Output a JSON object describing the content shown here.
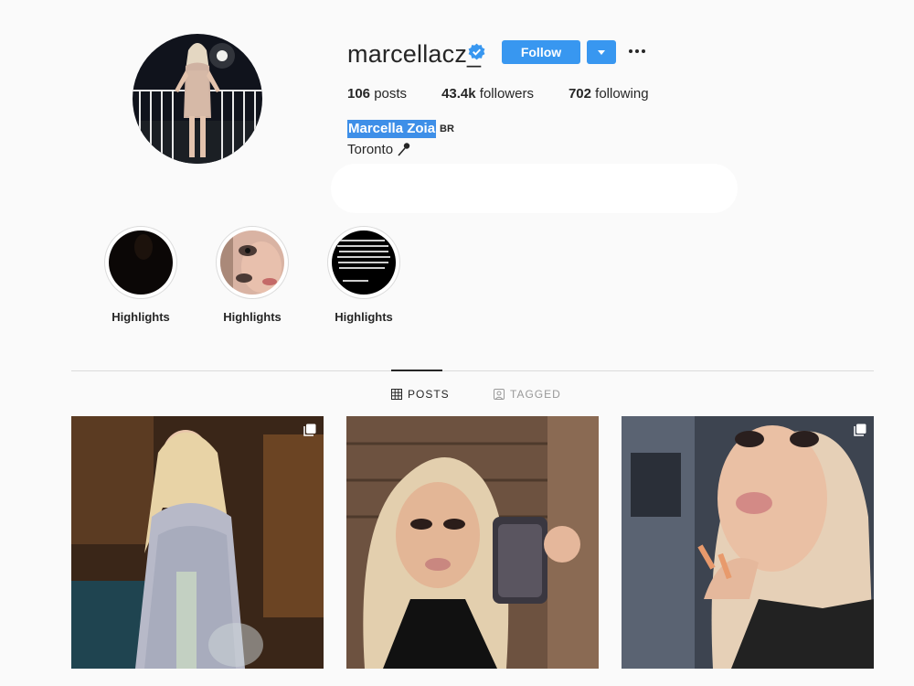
{
  "profile": {
    "username": "marcellacz_",
    "verified_icon": "verified-badge-icon",
    "follow_label": "Follow",
    "stats": {
      "posts_count": "106",
      "posts_label": " posts",
      "followers_count": "43.4k",
      "followers_label": " followers",
      "following_count": "702",
      "following_label": " following"
    },
    "full_name": "Marcella Zoia",
    "name_badge": "BR",
    "location": "Toronto"
  },
  "highlights": [
    {
      "label": "Highlights"
    },
    {
      "label": "Highlights"
    },
    {
      "label": "Highlights"
    }
  ],
  "tabs": {
    "posts": "POSTS",
    "tagged": "TAGGED"
  },
  "colors": {
    "accent": "#3897f0",
    "selection": "#3e8fe8",
    "background": "#fafafa"
  }
}
